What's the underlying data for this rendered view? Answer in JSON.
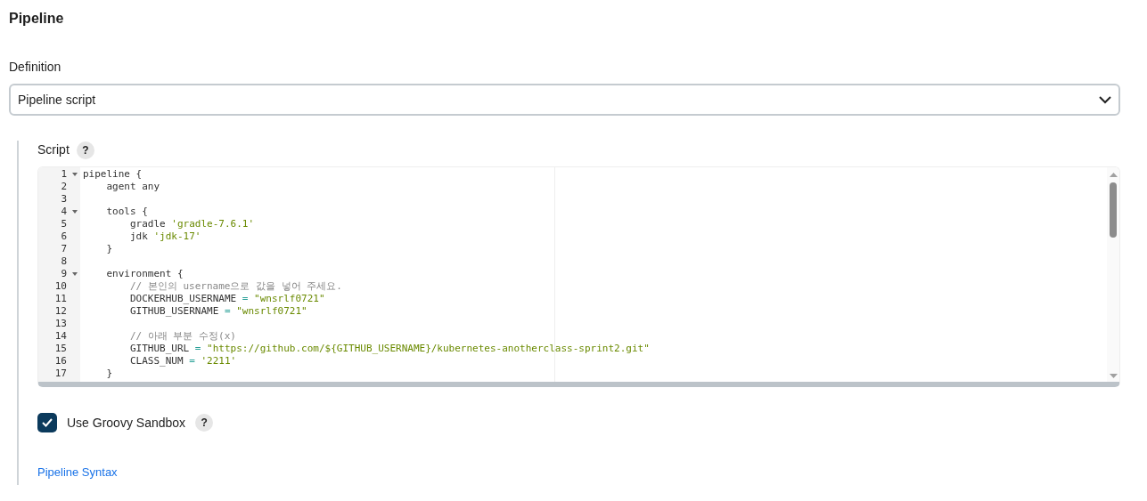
{
  "section_title": "Pipeline",
  "definition": {
    "label": "Definition",
    "value": "Pipeline script"
  },
  "script": {
    "label": "Script",
    "help": "?",
    "lines": [
      {
        "number": "1",
        "foldable": true,
        "tokens": [
          {
            "kind": "plain",
            "text": "pipeline {"
          }
        ]
      },
      {
        "number": "2",
        "foldable": false,
        "tokens": [
          {
            "kind": "plain",
            "text": "    agent any"
          }
        ]
      },
      {
        "number": "3",
        "foldable": false
      },
      {
        "number": "4",
        "foldable": true,
        "tokens": [
          {
            "kind": "plain",
            "text": "    tools {"
          }
        ]
      },
      {
        "number": "5",
        "foldable": false,
        "tokens": [
          {
            "kind": "plain",
            "text": "        gradle "
          },
          {
            "kind": "string",
            "text": "'gradle-7.6.1'"
          }
        ]
      },
      {
        "number": "6",
        "foldable": false,
        "tokens": [
          {
            "kind": "plain",
            "text": "        jdk "
          },
          {
            "kind": "string",
            "text": "'jdk-17'"
          }
        ]
      },
      {
        "number": "7",
        "foldable": false,
        "tokens": [
          {
            "kind": "plain",
            "text": "    }"
          }
        ]
      },
      {
        "number": "8",
        "foldable": false
      },
      {
        "number": "9",
        "foldable": true,
        "tokens": [
          {
            "kind": "plain",
            "text": "    environment {"
          }
        ]
      },
      {
        "number": "10",
        "foldable": false,
        "tokens": [
          {
            "kind": "comment",
            "text": "        // 본인의 username으로 값을 넣어 주세요."
          }
        ]
      },
      {
        "number": "11",
        "foldable": false,
        "tokens": [
          {
            "kind": "plain",
            "text": "        DOCKERHUB_USERNAME "
          },
          {
            "kind": "operator",
            "text": "= "
          },
          {
            "kind": "string",
            "text": "\"wnsrlf0721\""
          }
        ]
      },
      {
        "number": "12",
        "foldable": false,
        "tokens": [
          {
            "kind": "plain",
            "text": "        GITHUB_USERNAME "
          },
          {
            "kind": "operator",
            "text": "= "
          },
          {
            "kind": "string",
            "text": "\"wnsrlf0721\""
          }
        ]
      },
      {
        "number": "13",
        "foldable": false
      },
      {
        "number": "14",
        "foldable": false,
        "tokens": [
          {
            "kind": "comment",
            "text": "        // 아래 부분 수정(x)"
          }
        ]
      },
      {
        "number": "15",
        "foldable": false,
        "tokens": [
          {
            "kind": "plain",
            "text": "        GITHUB_URL "
          },
          {
            "kind": "operator",
            "text": "= "
          },
          {
            "kind": "string",
            "text": "\"https://github.com/${GITHUB_USERNAME}/kubernetes-anotherclass-sprint2.git\""
          }
        ]
      },
      {
        "number": "16",
        "foldable": false,
        "tokens": [
          {
            "kind": "plain",
            "text": "        CLASS_NUM "
          },
          {
            "kind": "operator",
            "text": "= "
          },
          {
            "kind": "string",
            "text": "'2211'"
          }
        ]
      },
      {
        "number": "17",
        "foldable": false,
        "tokens": [
          {
            "kind": "plain",
            "text": "    }"
          }
        ]
      }
    ]
  },
  "sandbox": {
    "label": "Use Groovy Sandbox",
    "checked": true,
    "help": "?"
  },
  "syntax_link": "Pipeline Syntax"
}
